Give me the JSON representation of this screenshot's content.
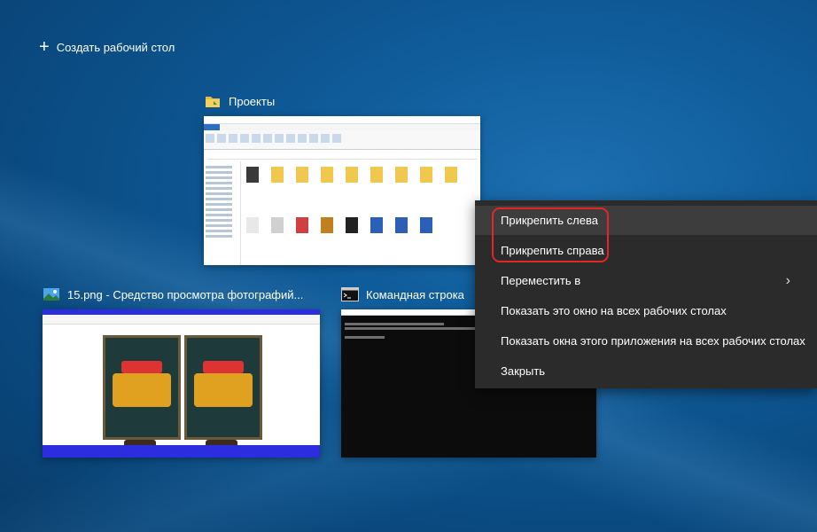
{
  "new_desktop": {
    "label": "Создать рабочий стол"
  },
  "windows": [
    {
      "title": "Проекты",
      "app": "explorer"
    },
    {
      "title": "15.png - Средство просмотра фотографий...",
      "app": "photos"
    },
    {
      "title": "Командная строка",
      "app": "cmd"
    }
  ],
  "context_menu": {
    "items": [
      {
        "label": "Прикрепить слева"
      },
      {
        "label": "Прикрепить справа"
      },
      {
        "label": "Переместить в",
        "submenu": true
      },
      {
        "label": "Показать это окно на всех рабочих столах"
      },
      {
        "label": "Показать окна этого приложения на всех рабочих столах"
      },
      {
        "label": "Закрыть"
      }
    ],
    "highlight_color": "#e32626"
  },
  "icons": {
    "new_desktop": "plus-icon",
    "explorer": "folder-icon",
    "photos": "photos-app-icon",
    "cmd": "cmd-icon",
    "submenu": "chevron-right-icon"
  },
  "colors": {
    "desktop_bg": "#0f5a98",
    "menu_bg": "#2b2b2b",
    "menu_hover": "#3d3d3d"
  }
}
